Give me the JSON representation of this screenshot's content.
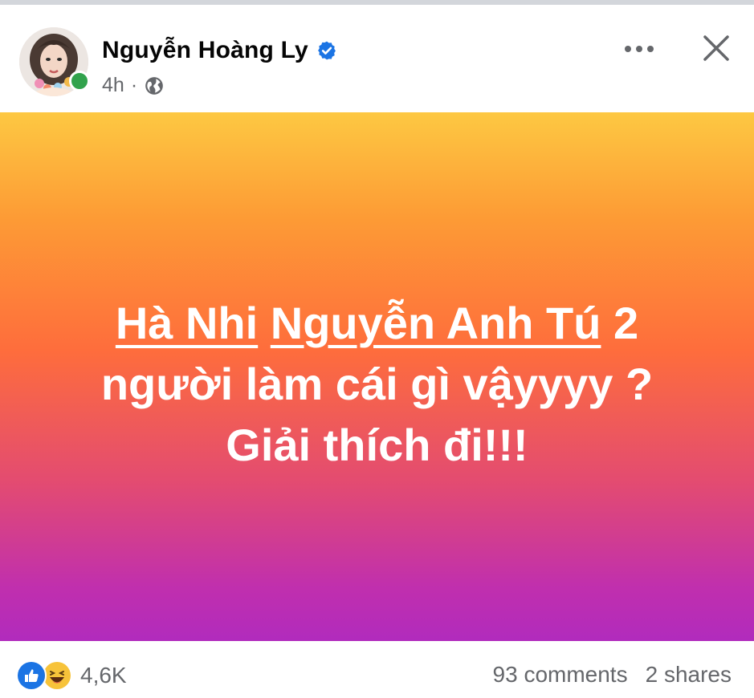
{
  "post": {
    "author": "Nguyễn Hoàng Ly",
    "time": "4h",
    "separator": "·",
    "body": {
      "mention_1": "Hà Nhi",
      "space_1": " ",
      "mention_2": "Nguyễn Anh Tú",
      "line1_rest": " 2",
      "line2": "người làm cái gì vậyyyy ?",
      "line3": "Giải thích đi!!!"
    },
    "reactions": {
      "count": "4,6K",
      "icons": [
        "like-icon",
        "haha-icon"
      ]
    },
    "comments": "93 comments",
    "shares": "2 shares"
  },
  "icons": {
    "verified": "verified-badge-icon",
    "audience": "globe-icon",
    "more": "more-horizontal-icon",
    "close": "close-icon"
  },
  "colors": {
    "like_blue": "#1b74e4",
    "haha_yellow": "#f7c33a",
    "online_green": "#31a24c",
    "gradient_top": "#fdc842",
    "gradient_bottom": "#b12bbd"
  }
}
